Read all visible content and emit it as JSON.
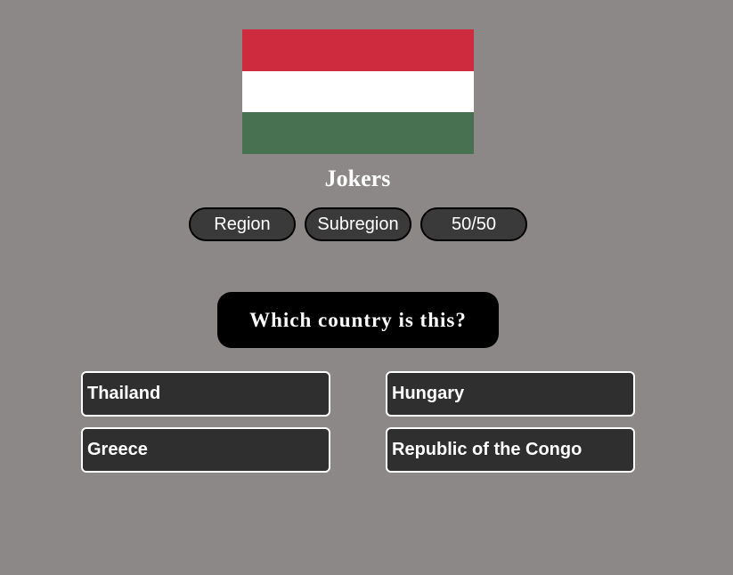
{
  "flag": {
    "stripes": [
      "#cf2b3e",
      "#ffffff",
      "#477150"
    ]
  },
  "jokers": {
    "title": "Jokers",
    "buttons": [
      "Region",
      "Subregion",
      "50/50"
    ]
  },
  "question": {
    "text": "Which country is this?"
  },
  "answers": [
    "Thailand",
    "Hungary",
    "Greece",
    "Republic of the Congo"
  ],
  "colors": {
    "background": "#8c8888",
    "button_bg": "#3a3a3a",
    "answer_bg": "#2f2f2f",
    "question_bg": "#000000"
  }
}
